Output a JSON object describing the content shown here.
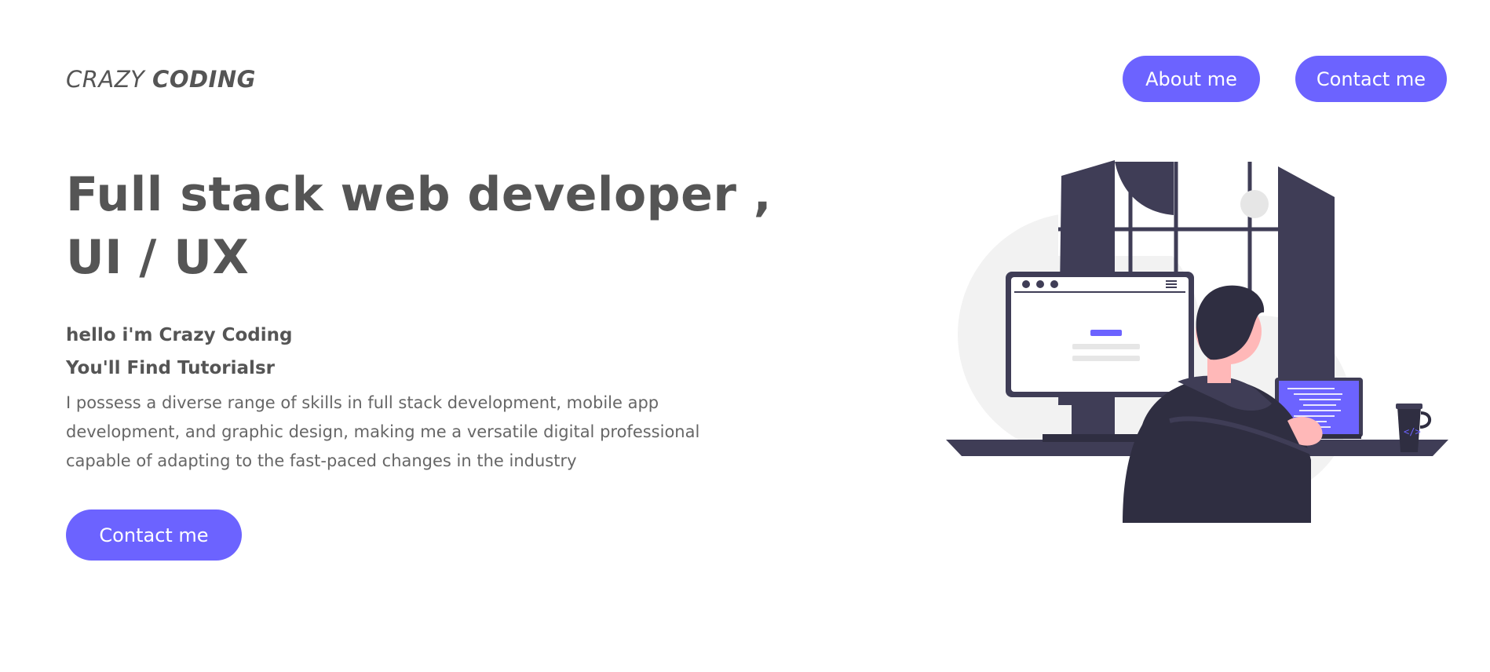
{
  "header": {
    "logo_light": "CRAZY ",
    "logo_bold": "CODING",
    "nav": {
      "about_label": "About me",
      "contact_label": "Contact me"
    }
  },
  "hero": {
    "title_line1": "Full stack web developer ,",
    "title_line2": "UI / UX",
    "intro_line1": "hello i'm Crazy Coding",
    "intro_line2": "You'll Find Tutorialsr",
    "description": "I possess a diverse range of skills in full stack development, mobile app development, and graphic design, making me a versatile digital professional capable of adapting to the fast-paced changes in the industry",
    "cta_label": "Contact me"
  },
  "colors": {
    "accent": "#6c63ff",
    "text": "#555555",
    "dark": "#3f3d56",
    "light_gray": "#f2f2f2"
  },
  "illustration": {
    "name": "developer-at-desk-illustration",
    "icons": [
      "window-shape",
      "monitor-shape",
      "laptop-shape",
      "person-shape",
      "coffee-mug-shape"
    ]
  }
}
